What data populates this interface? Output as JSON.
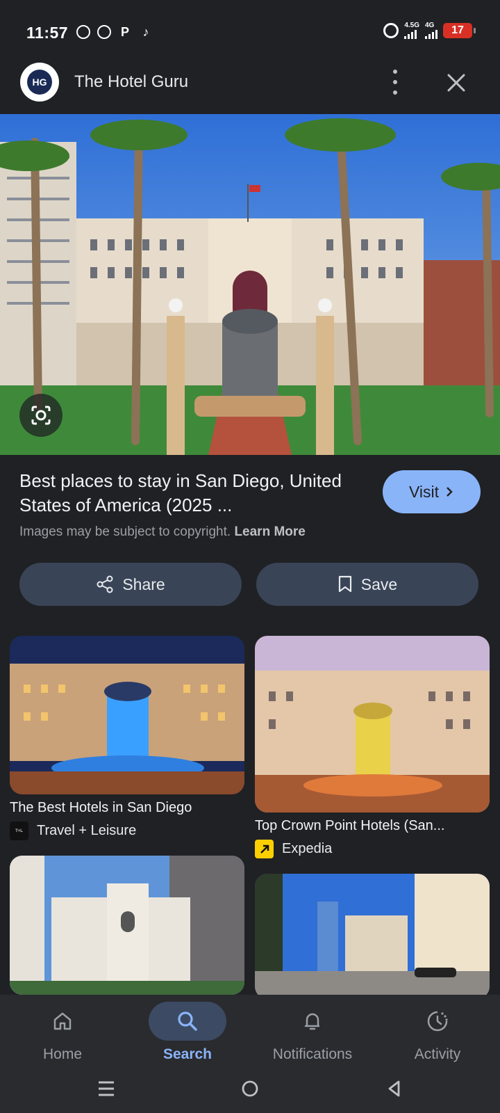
{
  "status_bar": {
    "time": "11:57",
    "app_icons": [
      "whatsapp-icon",
      "whatsapp-icon",
      "parking-app-icon",
      "tiktok-icon"
    ],
    "network_1": "4.5G",
    "network_2": "4G",
    "battery": "17",
    "battery_color": "#d93025"
  },
  "header": {
    "logo_text": "HG",
    "site_name": "The Hotel Guru"
  },
  "result": {
    "title": "Best places to stay in San Diego, United States of America (2025 ...",
    "visit_label": "Visit",
    "copyright_text": "Images may be subject to copyright.",
    "learn_more": "Learn More",
    "share_label": "Share",
    "save_label": "Save"
  },
  "related": [
    {
      "title": "The Best Hotels in San Diego",
      "source": "Travel + Leisure",
      "favicon_text": "T+L"
    },
    {
      "title": "Top Crown Point Hotels (San...",
      "source": "Expedia",
      "favicon_text": ""
    },
    {
      "title": "",
      "source": "",
      "favicon_text": ""
    },
    {
      "title": "",
      "source": "",
      "favicon_text": ""
    }
  ],
  "bottom_nav": [
    {
      "label": "Home",
      "icon": "home-icon"
    },
    {
      "label": "Search",
      "icon": "search-icon",
      "active": true
    },
    {
      "label": "Notifications",
      "icon": "bell-icon"
    },
    {
      "label": "Activity",
      "icon": "activity-icon"
    }
  ],
  "colors": {
    "accent": "#8ab4f8",
    "background": "#202124",
    "button": "#394457",
    "expedia": "#fcd000"
  }
}
